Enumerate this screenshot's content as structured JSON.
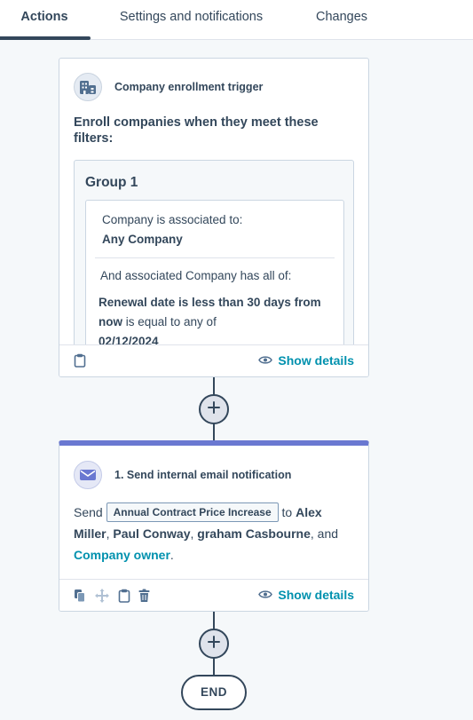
{
  "tabs": [
    {
      "label": "Actions",
      "active": true
    },
    {
      "label": "Settings and notifications",
      "active": false
    },
    {
      "label": "Changes",
      "active": false
    }
  ],
  "trigger": {
    "icon": "building-icon",
    "title": "Company enrollment trigger",
    "description": "Enroll companies when they meet these filters:",
    "group_title": "Group 1",
    "associated_label": "Company is associated to:",
    "associated_value": "Any Company",
    "and_label": "And associated Company has all of:",
    "filter_bold": "Renewal date is less than 30 days from now",
    "filter_rest": " is equal to any of",
    "filter_value": "02/12/2024",
    "show_details": "Show details"
  },
  "action": {
    "icon": "envelope-icon",
    "title": "1. Send internal email notification",
    "send_word": "Send",
    "email_name": "Annual Contract Price Increase",
    "to_word": "to",
    "recipient1": "Alex Miller",
    "recipient2": "Paul Conway",
    "recipient3": "graham Casbourne",
    "and_word": ", and",
    "recipient4": "Company owner",
    "show_details": "Show details"
  },
  "end_label": "END",
  "colors": {
    "background": "#f5f8fa",
    "text": "#33475b",
    "link": "#0091ae",
    "action_accent": "#6a78d1",
    "border": "#cbd6e2"
  }
}
